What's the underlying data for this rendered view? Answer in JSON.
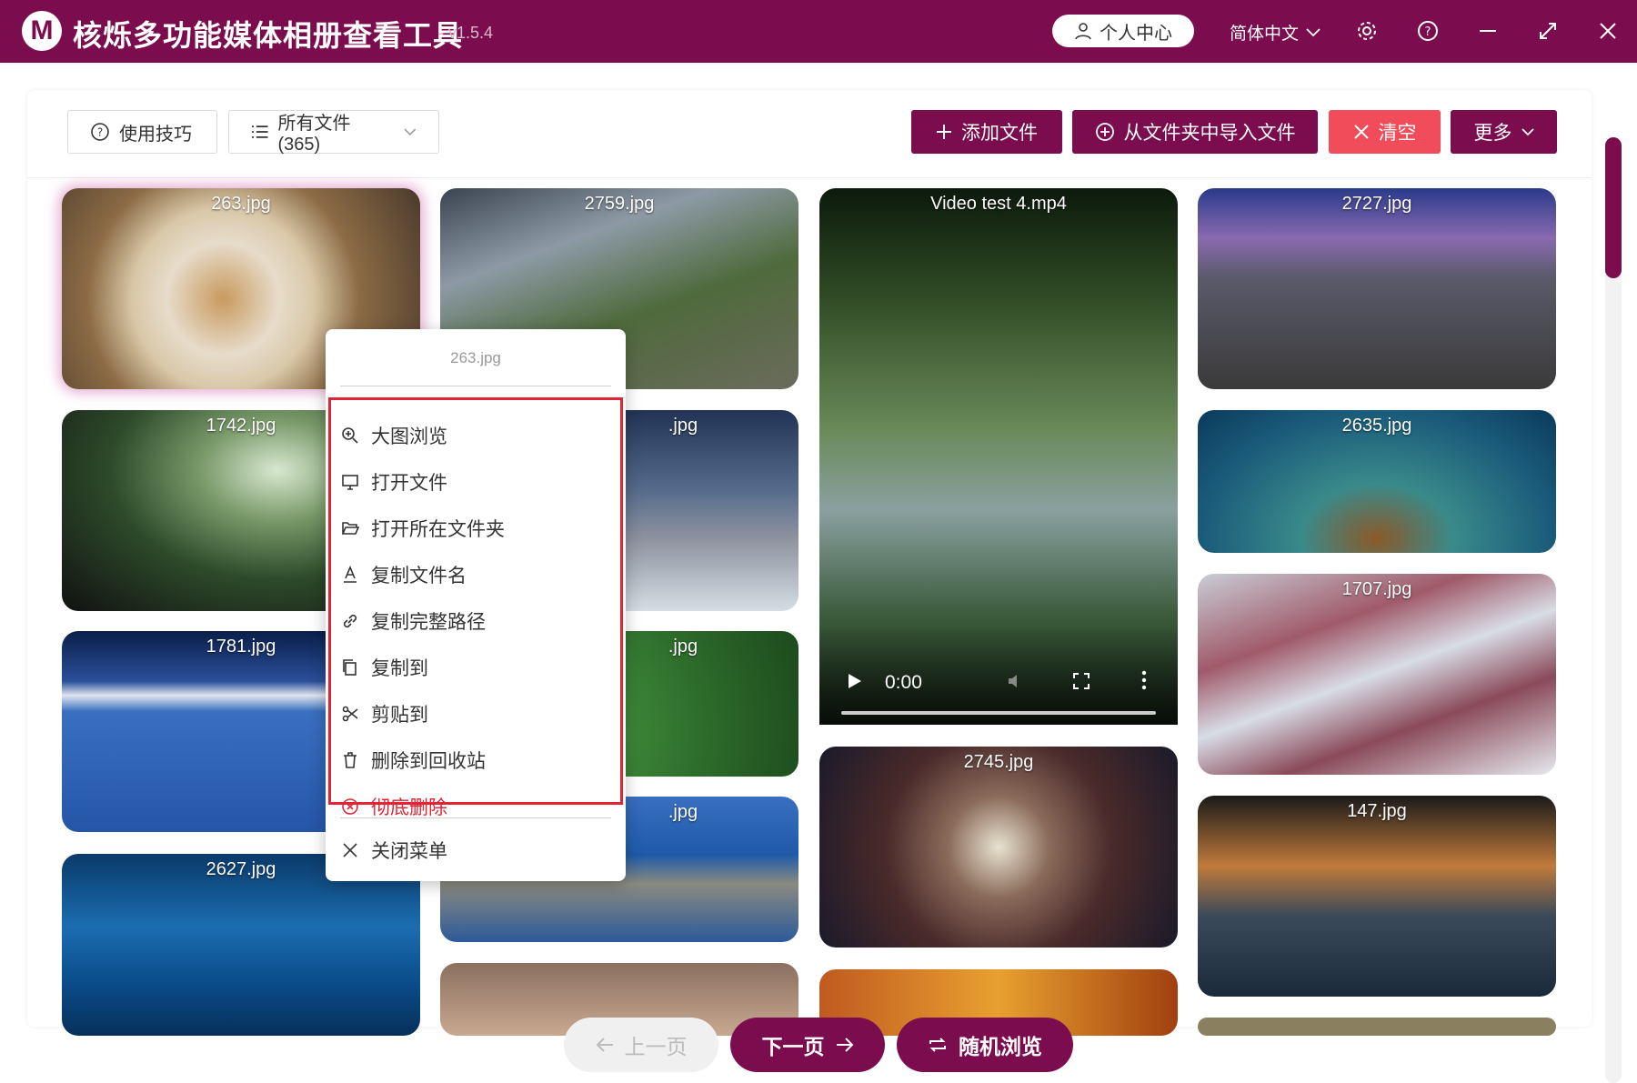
{
  "app": {
    "logo_letter": "M",
    "title": "核烁多功能媒体相册查看工具",
    "version": "- v1.5.4",
    "accent_color": "#7b0d4f"
  },
  "titlebar": {
    "user_center": "个人中心",
    "language": "简体中文",
    "icons": [
      "settings-icon",
      "help-icon",
      "minimize-icon",
      "maximize-icon",
      "close-icon"
    ]
  },
  "toolbar": {
    "tips_label": "使用技巧",
    "filter_label": "所有文件 (365)",
    "add_files": "添加文件",
    "import_folder": "从文件夹中导入文件",
    "clear": "清空",
    "more": "更多"
  },
  "gallery": [
    {
      "name": "263.jpg",
      "selected": true
    },
    {
      "name": "1742.jpg"
    },
    {
      "name": "1781.jpg"
    },
    {
      "name": "2627.jpg"
    },
    {
      "name": "2759.jpg"
    },
    {
      "name": ".jpg"
    },
    {
      "name": ".jpg"
    },
    {
      "name": ".jpg"
    },
    {
      "name": "Video test 4.mp4",
      "time": "0:00"
    },
    {
      "name": "2745.jpg"
    },
    {
      "name": "2727.jpg"
    },
    {
      "name": "2635.jpg"
    },
    {
      "name": "1707.jpg"
    },
    {
      "name": "147.jpg"
    }
  ],
  "context_menu": {
    "header": "263.jpg",
    "items": [
      "大图浏览",
      "打开文件",
      "打开所在文件夹",
      "复制文件名",
      "复制完整路径",
      "复制到",
      "剪贴到",
      "删除到回收站",
      "彻底删除"
    ],
    "close": "关闭菜单"
  },
  "pagination": {
    "prev": "上一页",
    "next": "下一页",
    "random": "随机浏览"
  }
}
